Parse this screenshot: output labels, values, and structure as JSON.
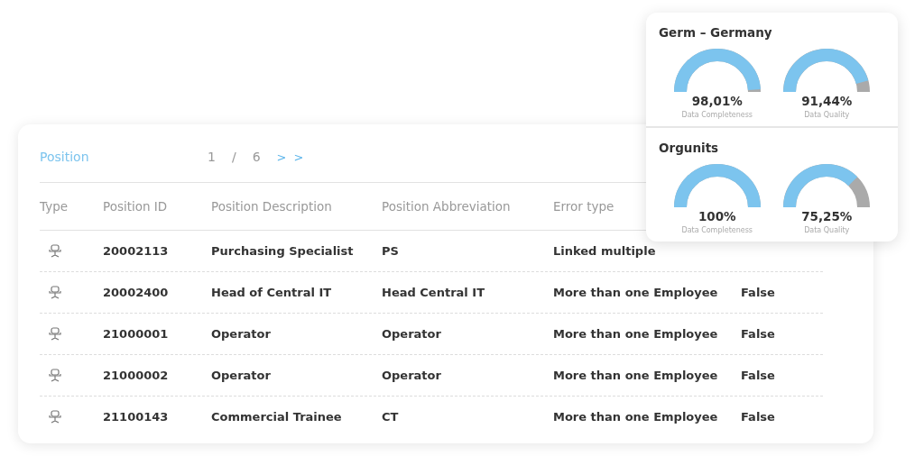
{
  "table_panel": {
    "title": "Position",
    "pager": {
      "current": "1",
      "separator": "/",
      "total": "6",
      "next": "> >"
    },
    "columns": [
      "Type",
      "Position ID",
      "Position Description",
      "Position Abbreviation",
      "Error type"
    ],
    "rows": [
      {
        "id": "20002113",
        "description": "Purchasing Specialist",
        "abbreviation": "PS",
        "error_type": "Linked multiple"
      },
      {
        "id": "20002400",
        "description": "Head of Central IT",
        "abbreviation": "Head Central IT",
        "error_type": "More than one Employee",
        "column_6": "False"
      },
      {
        "id": "21000001",
        "description": "Operator",
        "abbreviation": "Operator",
        "error_type": "More than one Employee",
        "column_6": "False"
      },
      {
        "id": "21000002",
        "description": "Operator",
        "abbreviation": "Operator",
        "error_type": "More than one Employee",
        "column_6": "False"
      },
      {
        "id": "21100143",
        "description": "Commercial Trainee",
        "abbreviation": "CT",
        "error_type": "More than one Employee",
        "column_6": "False"
      }
    ]
  },
  "stats_card": {
    "sections": [
      {
        "title": "Germ – Germany",
        "gauges": [
          {
            "value": "98,01%",
            "label": "Data Completeness"
          },
          {
            "value": "91,44%",
            "label": "Data Quality"
          }
        ]
      },
      {
        "title": "Orgunits",
        "gauges": [
          {
            "value": "100%",
            "label": "Data Completeness"
          },
          {
            "value": "75,25%",
            "label": "Data Quality"
          }
        ]
      }
    ]
  }
}
